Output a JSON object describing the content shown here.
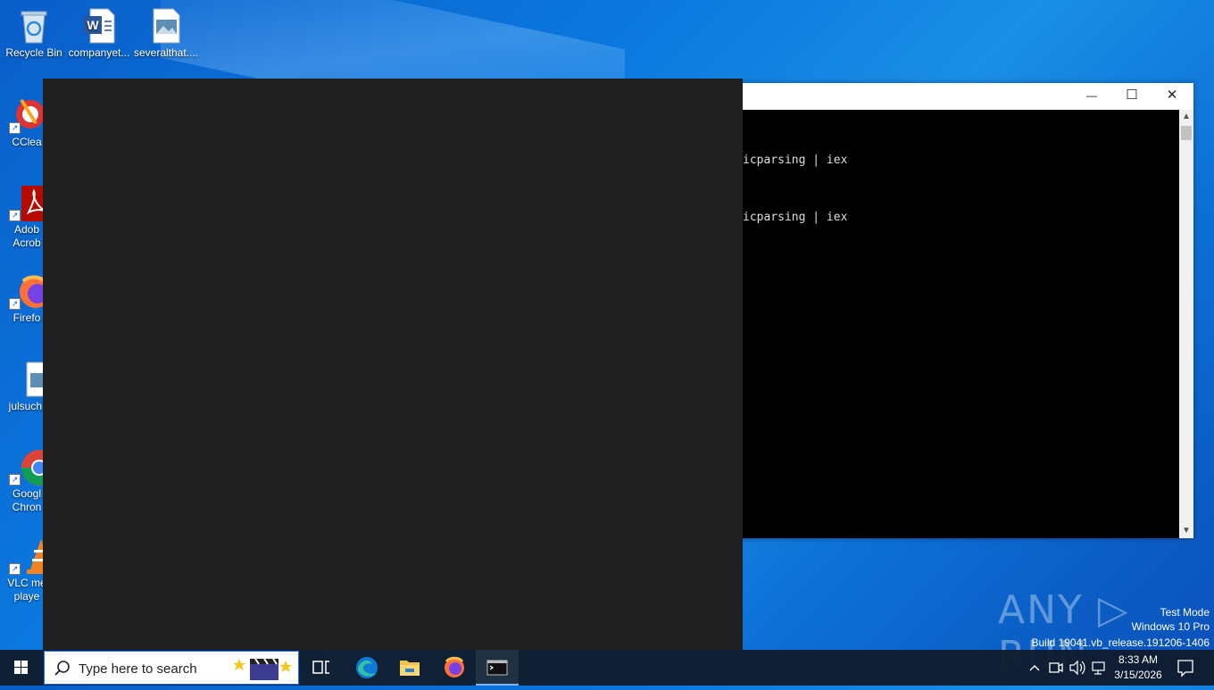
{
  "desktop": {
    "icons": [
      {
        "label": "Recycle Bin"
      },
      {
        "label": "companyet..."
      },
      {
        "label": "severalthat...."
      },
      {
        "label": "CClea"
      },
      {
        "label": "Adob\nAcrob"
      },
      {
        "label": "Firefo"
      },
      {
        "label": "julsuch."
      },
      {
        "label": "Googl\nChron"
      },
      {
        "label": "VLC me\nplaye"
      }
    ]
  },
  "console": {
    "lines": [
      "icparsing | iex",
      "icparsing | iex"
    ],
    "minimize": "—",
    "maximize": "☐",
    "close": "✕"
  },
  "watermark": {
    "logo": "ANY ▷ RUN",
    "line1": "Test Mode",
    "line2": "Windows 10 Pro",
    "line3": "Build 19041.vb_release.191206-1406"
  },
  "taskbar": {
    "search_placeholder": "Type here to search",
    "clock_time": "8:33 AM",
    "clock_date": "3/15/2026"
  },
  "colors": {
    "taskbar": "#101c2e",
    "search_border": "#1a73e8",
    "overlay": "#202020",
    "console_bg": "#000000"
  }
}
